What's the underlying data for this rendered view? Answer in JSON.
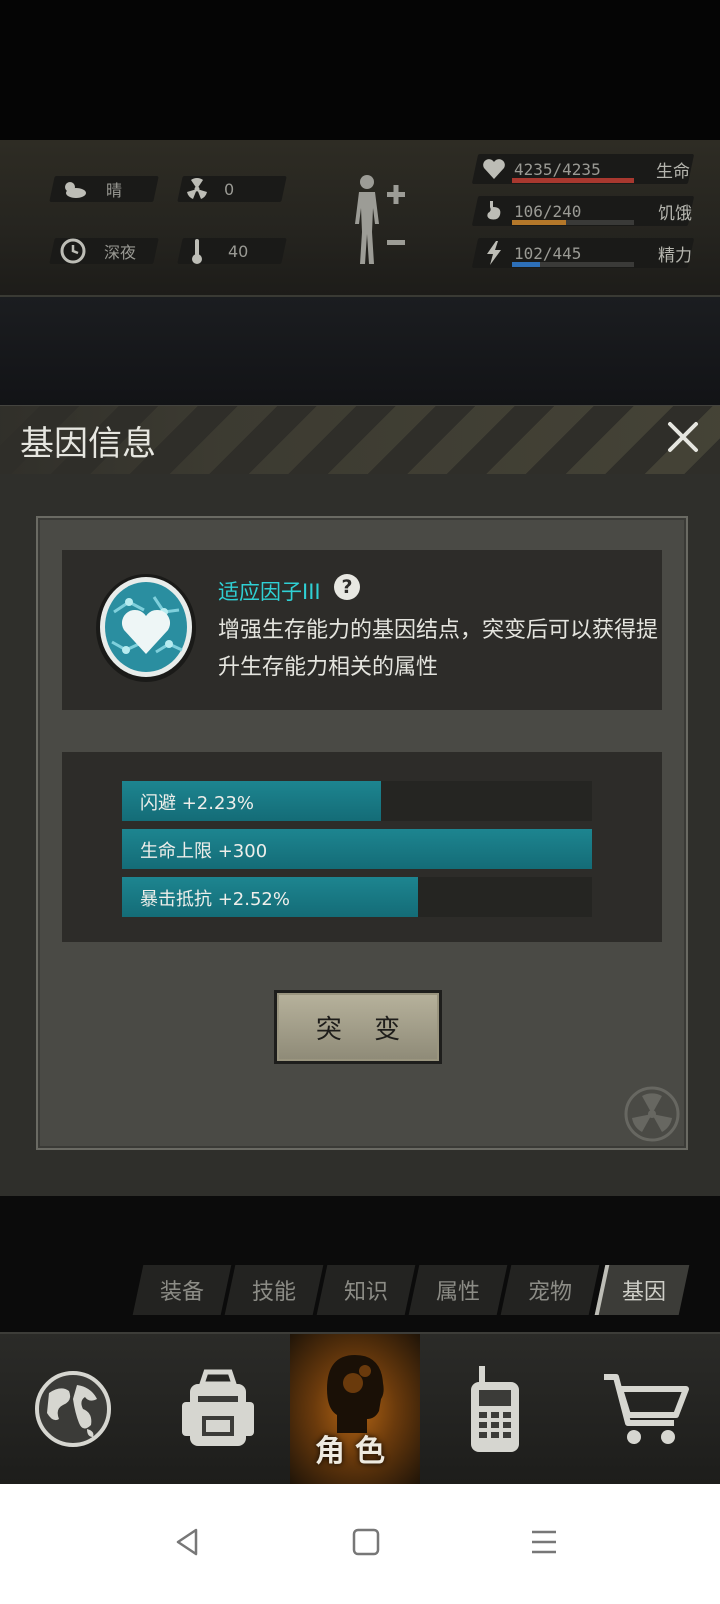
{
  "status": {
    "weather": {
      "icon": "weather-icon",
      "value": "晴"
    },
    "radiation": {
      "icon": "radiation-icon",
      "value": "0"
    },
    "time": {
      "icon": "clock-icon",
      "value": "深夜"
    },
    "temperature": {
      "icon": "thermometer-icon",
      "value": "40"
    },
    "health": {
      "value": "4235/4235",
      "label": "生命",
      "fraction": 1.0,
      "color": "#a8382f"
    },
    "hunger": {
      "value": "106/240",
      "label": "饥饿",
      "fraction": 0.44,
      "color": "#b5782a"
    },
    "energy": {
      "value": "102/445",
      "label": "精力",
      "fraction": 0.23,
      "color": "#2d6fb8"
    }
  },
  "dialog": {
    "title": "基因信息",
    "gene": {
      "name": "适应因子III",
      "help": "?",
      "description": "增强生存能力的基因结点，突变后可以获得提升生存能力相关的属性"
    },
    "stats": [
      {
        "label": "闪避 +2.23%",
        "fraction": 0.55
      },
      {
        "label": "生命上限 +300",
        "fraction": 1.0
      },
      {
        "label": "暴击抵抗 +2.52%",
        "fraction": 0.63
      }
    ],
    "mutate_button": "突 变"
  },
  "tabs": [
    "装备",
    "技能",
    "知识",
    "属性",
    "宠物",
    "基因"
  ],
  "active_tab": "基因",
  "bottom_nav": {
    "active_label": "角色"
  },
  "colors": {
    "accent": "#2fd0d4",
    "stat_fill": "#1d8590"
  }
}
